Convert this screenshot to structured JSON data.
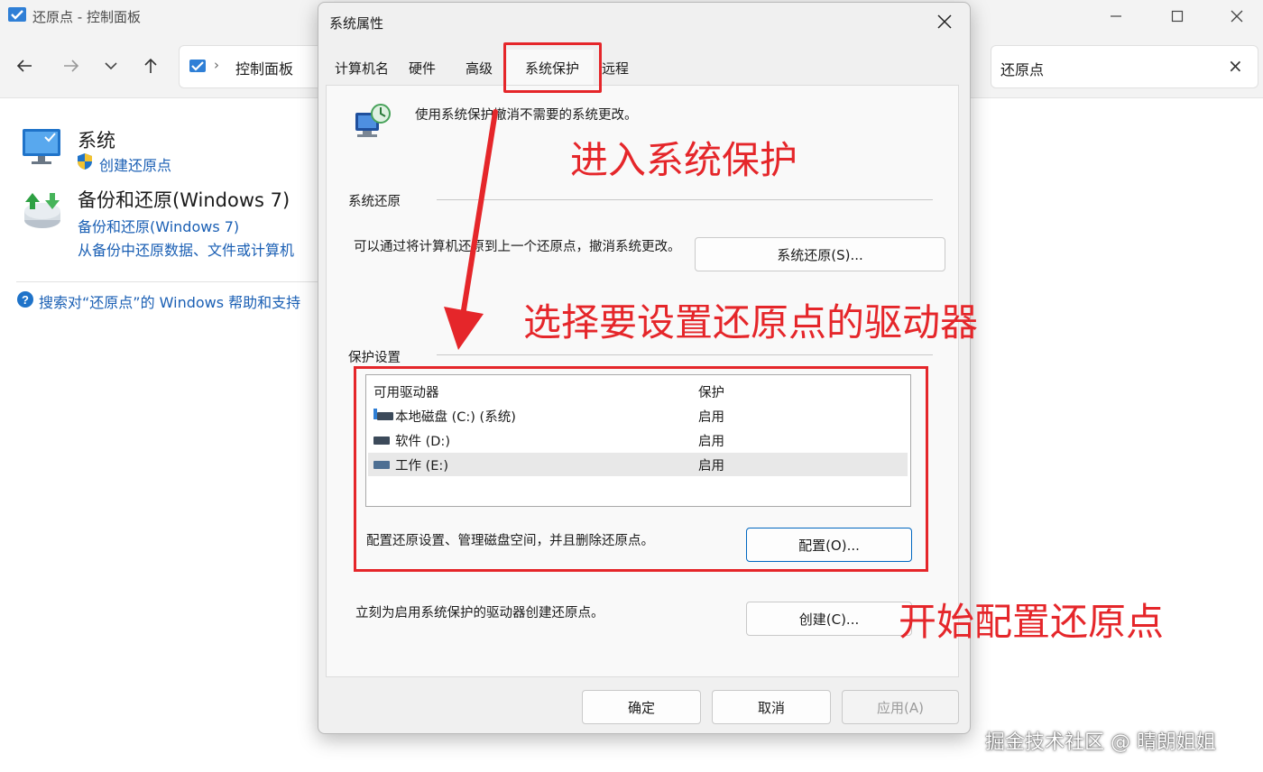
{
  "window": {
    "title": "还原点 - 控制面板",
    "breadcrumb": "控制面板",
    "search_value": "还原点",
    "search_clear": "×"
  },
  "results": {
    "system": {
      "title": "系统",
      "link": "创建还原点"
    },
    "backup": {
      "title": "备份和还原(Windows 7)",
      "link1": "备份和还原(Windows 7)",
      "link2": "从备份中还原数据、文件或计算机"
    },
    "help_link": "搜索对“还原点”的 Windows 帮助和支持"
  },
  "dialog": {
    "title": "系统属性",
    "tabs": [
      "计算机名",
      "硬件",
      "高级",
      "系统保护",
      "远程"
    ],
    "active_tab": "系统保护",
    "intro": "使用系统保护撤消不需要的系统更改。",
    "restore_section": {
      "heading": "系统还原",
      "description": "可以通过将计算机还原到上一个还原点，撤消系统更改。",
      "button": "系统还原(S)..."
    },
    "protection_section": {
      "heading": "保护设置",
      "columns": [
        "可用驱动器",
        "保护"
      ],
      "drives": [
        {
          "name": "本地磁盘 (C:) (系统)",
          "status": "启用"
        },
        {
          "name": "软件 (D:)",
          "status": "启用"
        },
        {
          "name": "工作 (E:)",
          "status": "启用"
        }
      ],
      "configure_text": "配置还原设置、管理磁盘空间，并且删除还原点。",
      "configure_button": "配置(O)...",
      "create_text": "立刻为启用系统保护的驱动器创建还原点。",
      "create_button": "创建(C)..."
    },
    "footer": {
      "ok": "确定",
      "cancel": "取消",
      "apply": "应用(A)"
    }
  },
  "annotations": {
    "step1": "进入系统保护",
    "step2": "选择要设置还原点的驱动器",
    "step3": "开始配置还原点",
    "color": "#e5262a"
  },
  "watermark": "掘金技术社区 @ 晴朗姐姐",
  "colors": {
    "link": "#1a5fb4",
    "accent": "#0067c0"
  }
}
